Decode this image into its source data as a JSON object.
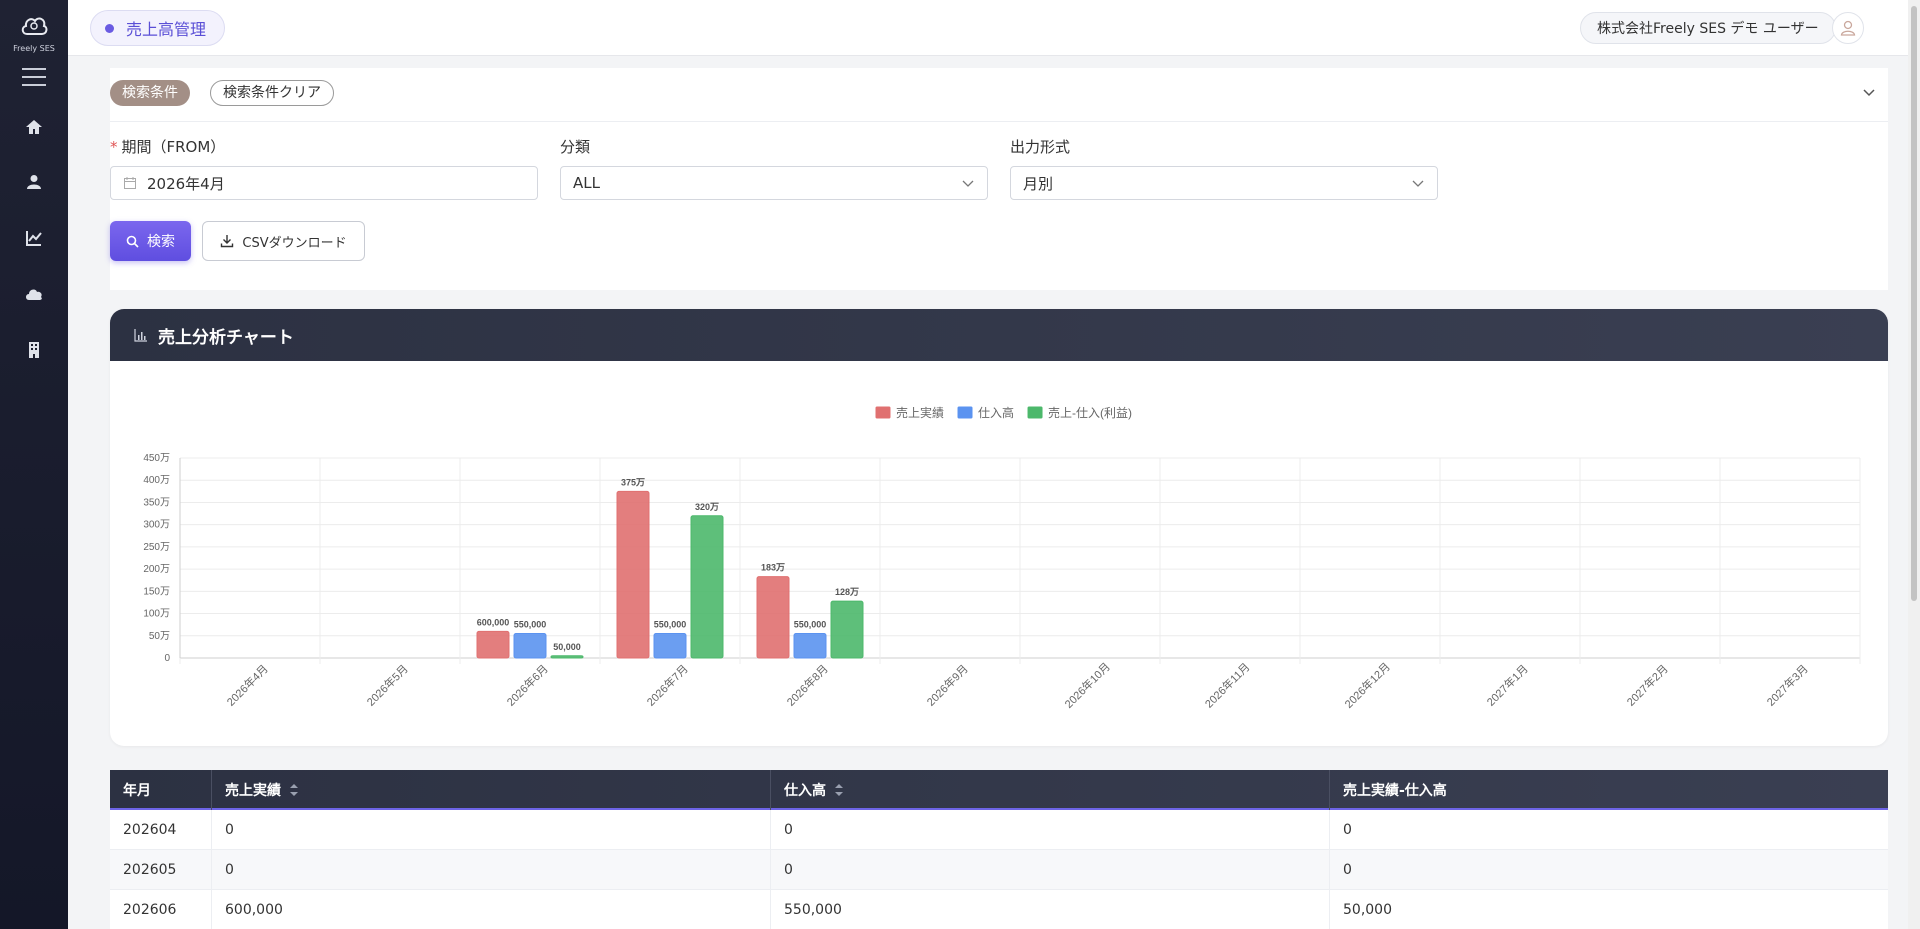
{
  "app": {
    "logo_text": "Freely SES"
  },
  "sidebar": {
    "items": [
      {
        "icon": "home-icon"
      },
      {
        "icon": "user-icon"
      },
      {
        "icon": "chart-icon"
      },
      {
        "icon": "cloud-icon"
      },
      {
        "icon": "building-icon"
      }
    ]
  },
  "header": {
    "breadcrumb": "売上高管理",
    "user_label": "株式会社Freely SES デモ ユーザー"
  },
  "search": {
    "conditions_tag": "検索条件",
    "clear_button": "検索条件クリア",
    "period_label": "期間（FROM）",
    "period_value": "2026年4月",
    "category_label": "分類",
    "category_value": "ALL",
    "output_label": "出力形式",
    "output_value": "月別",
    "search_button": "検索",
    "csv_button": "CSVダウンロード"
  },
  "chart_card": {
    "title": "売上分析チャート"
  },
  "chart_data": {
    "type": "bar",
    "categories": [
      "2026年4月",
      "2026年5月",
      "2026年6月",
      "2026年7月",
      "2026年8月",
      "2026年9月",
      "2026年10月",
      "2026年11月",
      "2026年12月",
      "2027年1月",
      "2027年2月",
      "2027年3月"
    ],
    "series": [
      {
        "name": "売上実績",
        "color": "#e07070",
        "values": [
          0,
          0,
          600000,
          3750000,
          1830000,
          0,
          0,
          0,
          0,
          0,
          0,
          0
        ],
        "labels": [
          "",
          "",
          "600,000",
          "375万",
          "183万",
          "",
          "",
          "",
          "",
          "",
          "",
          ""
        ]
      },
      {
        "name": "仕入高",
        "color": "#5b93f0",
        "values": [
          0,
          0,
          550000,
          550000,
          550000,
          0,
          0,
          0,
          0,
          0,
          0,
          0
        ],
        "labels": [
          "",
          "",
          "550,000",
          "550,000",
          "550,000",
          "",
          "",
          "",
          "",
          "",
          "",
          ""
        ]
      },
      {
        "name": "売上-仕入(利益)",
        "color": "#4cb86b",
        "values": [
          0,
          0,
          50000,
          3200000,
          1280000,
          0,
          0,
          0,
          0,
          0,
          0,
          0
        ],
        "labels": [
          "",
          "",
          "50,000",
          "320万",
          "128万",
          "",
          "",
          "",
          "",
          "",
          "",
          ""
        ]
      }
    ],
    "yticks": [
      "0",
      "50万",
      "100万",
      "150万",
      "200万",
      "250万",
      "300万",
      "350万",
      "400万",
      "450万"
    ],
    "ylim": [
      0,
      4500000
    ],
    "legend": "top-center",
    "grid": true
  },
  "table": {
    "headers": [
      "年月",
      "売上実績",
      "仕入高",
      "売上実績-仕入高"
    ],
    "rows": [
      [
        "202604",
        "0",
        "0",
        "0"
      ],
      [
        "202605",
        "0",
        "0",
        "0"
      ],
      [
        "202606",
        "600,000",
        "550,000",
        "50,000"
      ]
    ]
  }
}
